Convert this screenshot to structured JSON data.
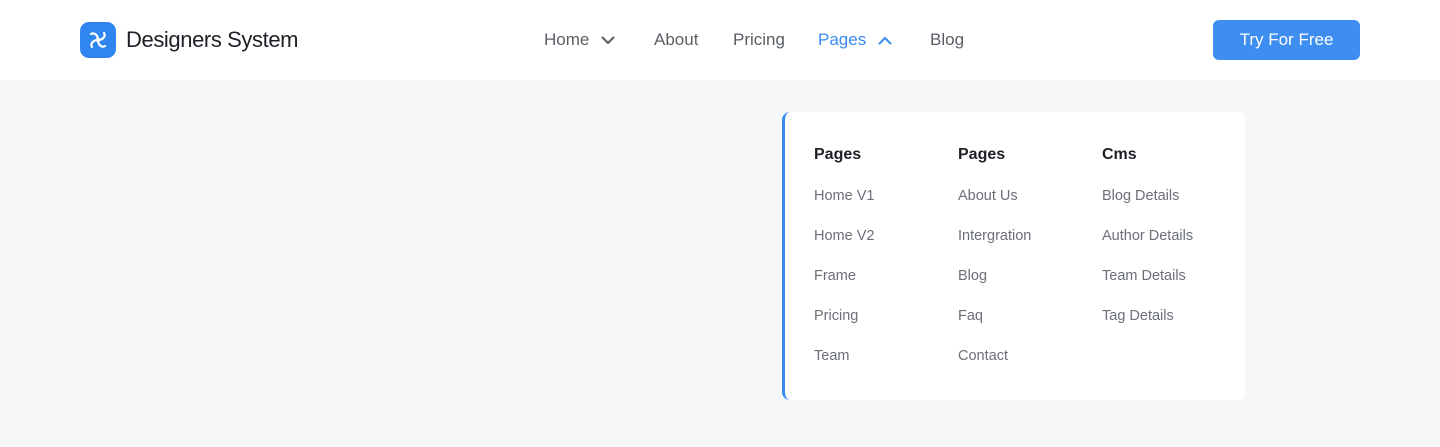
{
  "brand": {
    "name": "Designers System",
    "icon": "swirl-logo-icon",
    "color": "#2f86ef"
  },
  "nav": {
    "items": [
      {
        "label": "Home",
        "has_chevron": true,
        "chevron": "chevron-down-icon"
      },
      {
        "label": "About"
      },
      {
        "label": "Pricing"
      },
      {
        "label": "Pages",
        "active": true,
        "has_chevron": true,
        "chevron": "chevron-up-icon"
      },
      {
        "label": "Blog"
      }
    ],
    "active_color": "#3a8bee"
  },
  "cta": {
    "label": "Try For Free",
    "color": "#3d8ef0"
  },
  "dropdown": {
    "columns": [
      {
        "heading": "Pages",
        "links": [
          "Home V1",
          "Home V2",
          "Frame",
          "Pricing",
          "Team"
        ]
      },
      {
        "heading": "Pages",
        "links": [
          "About Us",
          "Intergration",
          "Blog",
          "Faq",
          "Contact"
        ]
      },
      {
        "heading": "Cms",
        "links": [
          "Blog Details",
          "Author Details",
          "Team Details",
          "Tag Details"
        ]
      }
    ]
  }
}
